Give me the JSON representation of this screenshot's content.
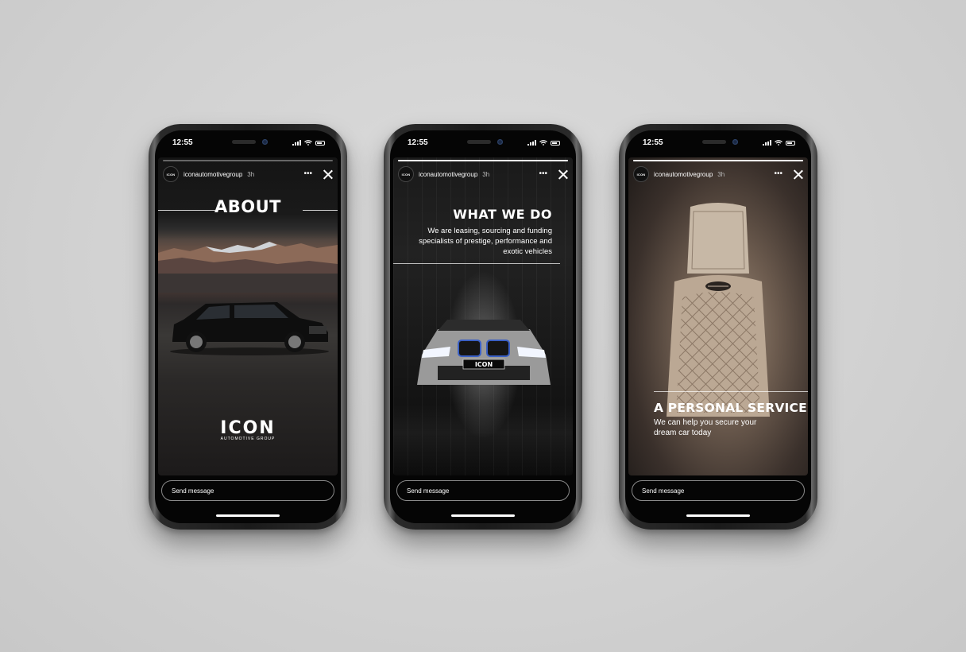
{
  "phones": [
    {
      "status_time": "12:55",
      "avatar_text": "ICON",
      "username": "iconautomotivegroup",
      "time_ago": "3h",
      "story_progress": 0.0,
      "story_title": "ABOUT",
      "logo_main": "ICON",
      "logo_sub": "AUTOMOTIVE GROUP",
      "send_placeholder": "Send message"
    },
    {
      "status_time": "12:55",
      "avatar_text": "ICON",
      "username": "iconautomotivegroup",
      "time_ago": "3h",
      "story_progress": 1.0,
      "story_title": "WHAT WE DO",
      "story_text": "We are leasing, sourcing and funding specialists of prestige, performance and exotic vehicles",
      "plate_text": "ICON",
      "send_placeholder": "Send message"
    },
    {
      "status_time": "12:55",
      "avatar_text": "ICON",
      "username": "iconautomotivegroup",
      "time_ago": "3h",
      "story_progress": 1.0,
      "story_title": "A PERSONAL SERVICE",
      "story_text": "We can help you secure your dream car today",
      "send_placeholder": "Send message"
    }
  ],
  "icons": {
    "more": "more-horizontal-icon",
    "close": "close-icon",
    "signal": "signal-icon",
    "wifi": "wifi-icon",
    "battery": "battery-icon"
  }
}
